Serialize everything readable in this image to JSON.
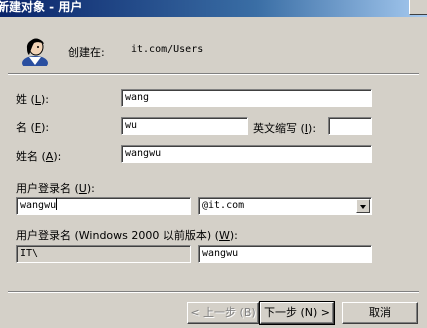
{
  "window": {
    "title": "新建对象 - 用户"
  },
  "header": {
    "created_in_label": "创建在:",
    "created_in_value": "it.com/Users",
    "icon": "user-icon"
  },
  "form": {
    "last_name": {
      "label_pre": "姓 (",
      "label_key": "L",
      "label_post": "):",
      "value": "wang"
    },
    "first_name": {
      "label_pre": "名 (",
      "label_key": "F",
      "label_post": "):",
      "value": "wu"
    },
    "initials": {
      "label_pre": "英文缩写 (",
      "label_key": "I",
      "label_post": "):",
      "value": ""
    },
    "full_name": {
      "label_pre": "姓名 (",
      "label_key": "A",
      "label_post": "):",
      "value": "wangwu"
    },
    "logon_name": {
      "label_pre": "用户登录名 (",
      "label_key": "U",
      "label_post": "):",
      "value": "wangwu"
    },
    "upn_suffix": {
      "value": "@it.com"
    },
    "pre2000_logon": {
      "label_pre": "用户登录名 (Windows 2000 以前版本) (",
      "label_key": "W",
      "label_post": "):"
    },
    "domain_prefix": {
      "value": "IT\\"
    },
    "pre2000_name": {
      "value": "wangwu"
    }
  },
  "buttons": {
    "back": "< 上一步 (B)",
    "next": "下一步 (N) >",
    "cancel": "取消"
  },
  "colors": {
    "titlebar_start": "#0a246a",
    "face": "#d4d0c8"
  }
}
